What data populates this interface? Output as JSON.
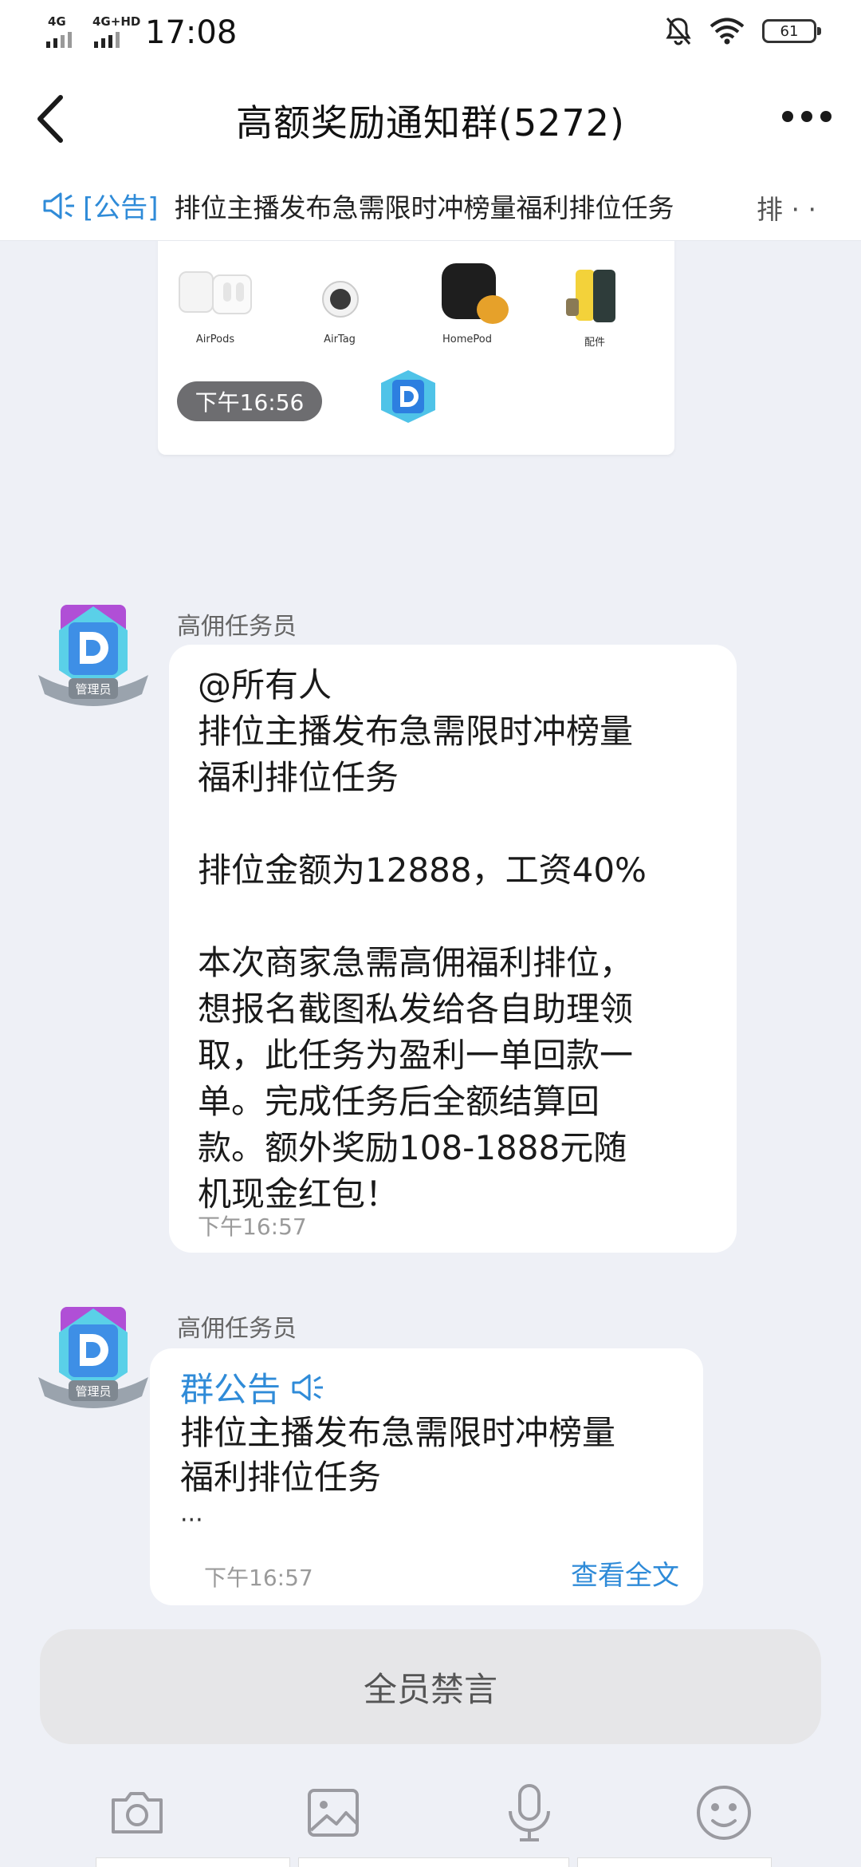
{
  "status_bar": {
    "net1_label": "4G",
    "net2_label": "4G+HD",
    "time": "17:08",
    "battery": "61"
  },
  "header": {
    "title": "高额奖励通知群(5272)"
  },
  "notice_bar": {
    "tag": "[公告]",
    "text": "排位主播发布急需限时冲榜量福利排位任务",
    "next": "排 · ·"
  },
  "image_message": {
    "products": [
      "AirPods",
      "AirTag",
      "HomePod",
      "配件"
    ],
    "time": "下午16:56"
  },
  "messages": [
    {
      "sender": "高佣任务员",
      "badge": "管理员",
      "text": "@所有人\n排位主播发布急需限时冲榜量\n福利排位任务\n\n排位金额为12888，工资40%\n\n本次商家急需高佣福利排位，\n想报名截图私发给各自助理领\n取，此任务为盈利一单回款一\n单。完成任务后全额结算回\n款。额外奖励108-1888元随\n机现金红包！",
      "time": "下午16:57"
    },
    {
      "sender": "高佣任务员",
      "badge": "管理员",
      "announcement_title": "群公告",
      "text": "排位主播发布急需限时冲榜量\n福利排位任务",
      "ellipsis": "···",
      "time": "下午16:57",
      "link": "查看全文"
    }
  ],
  "mute_label": "全员禁言",
  "toolbar": [
    "camera-icon",
    "image-icon",
    "microphone-icon",
    "emoji-icon"
  ],
  "colors": {
    "accent": "#2f8bd8",
    "background": "#eef0f6",
    "bubble": "#ffffff"
  }
}
